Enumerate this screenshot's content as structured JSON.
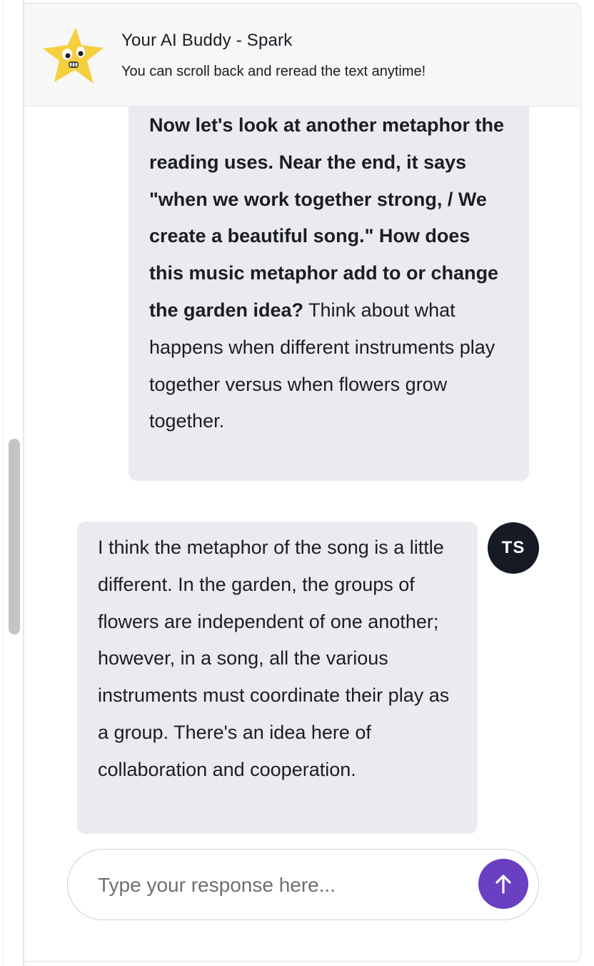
{
  "header": {
    "title": "Your AI Buddy - Spark",
    "subtitle": "You can scroll back and reread the text anytime!",
    "mascot_icon": "star-mascot-icon"
  },
  "messages": {
    "ai": {
      "bold_text": "Now let's look at another metaphor the reading uses. Near the end, it says \"when we work together strong, / We create a beautiful song.\" How does this music metaphor add to or change the garden idea?",
      "plain_text": " Think about what happens when different instruments play together versus when flowers grow together."
    },
    "user": {
      "avatar_initials": "TS",
      "text": "I think the metaphor of the song is a little different. In the garden, the groups of flowers are independent of one another; however, in a song, all the various instruments must coordinate their play as a group. There's an idea here of collaboration and cooperation."
    }
  },
  "composer": {
    "placeholder": "Type your response here...",
    "send_icon": "arrow-up-icon"
  },
  "colors": {
    "accent": "#6a3fc1",
    "bubble": "#ebebef",
    "avatar": "#151a24",
    "header_bg": "#f7f7f8",
    "mascot": "#f6cf3f"
  }
}
